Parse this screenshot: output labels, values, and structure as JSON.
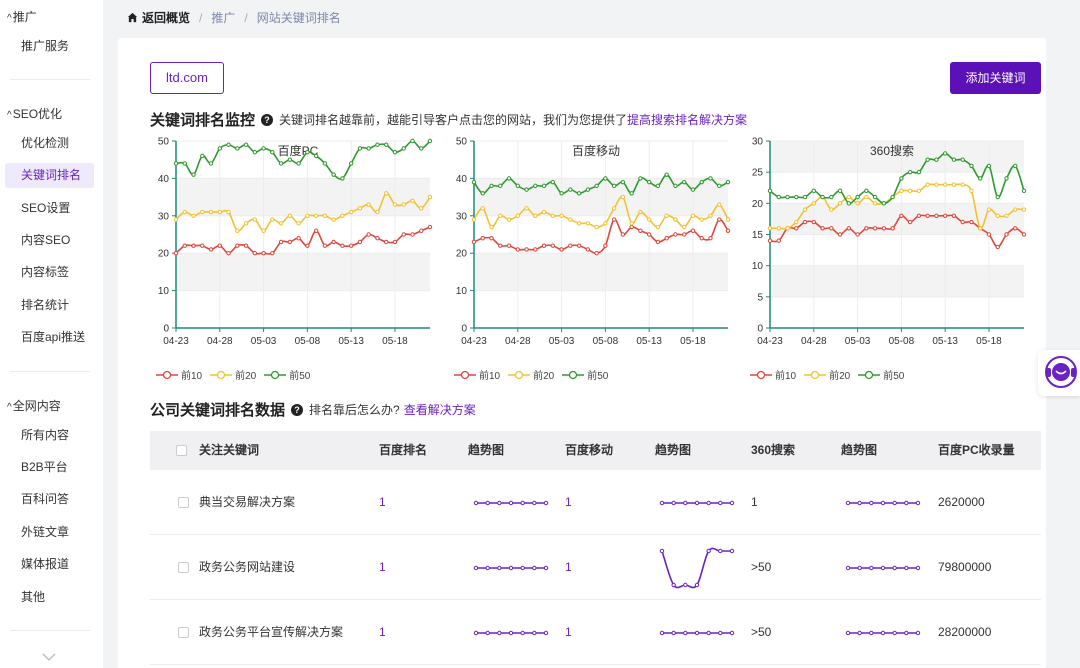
{
  "sidebar": {
    "groups": [
      {
        "title": "推广",
        "items": [
          "推广服务"
        ]
      },
      {
        "title": "SEO优化",
        "items": [
          "优化检测",
          "关键词排名",
          "SEO设置",
          "内容SEO",
          "内容标签",
          "排名统计",
          "百度api推送"
        ]
      },
      {
        "title": "全网内容",
        "items": [
          "所有内容",
          "B2B平台",
          "百科问答",
          "外链文章",
          "媒体报道",
          "其他"
        ]
      }
    ],
    "active_item": "关键词排名",
    "caret": "^"
  },
  "breadcrumb": {
    "home": "返回概览",
    "items": [
      "推广",
      "网站关键词排名"
    ],
    "separator": "/"
  },
  "toolbar": {
    "domain": "ltd.com",
    "add_button": "添加关键词"
  },
  "monitor": {
    "title": "关键词排名监控",
    "desc": "关键词排名越靠前，越能引导客户点击您的网站，我们为您提供了",
    "link": "提高搜索排名解决方案"
  },
  "chart_data": [
    {
      "type": "line",
      "title": "百度PC",
      "x": [
        "04-23",
        "04-24",
        "04-25",
        "04-26",
        "04-27",
        "04-28",
        "04-29",
        "04-30",
        "05-01",
        "05-02",
        "05-03",
        "05-04",
        "05-05",
        "05-06",
        "05-07",
        "05-08",
        "05-09",
        "05-10",
        "05-11",
        "05-12",
        "05-13",
        "05-14",
        "05-15",
        "05-16",
        "05-17",
        "05-18",
        "05-19",
        "05-20",
        "05-21",
        "05-22"
      ],
      "xticks": [
        "04-23",
        "04-28",
        "05-03",
        "05-08",
        "05-13",
        "05-18"
      ],
      "ylim": [
        0,
        50
      ],
      "yticks": [
        0,
        10,
        20,
        30,
        40,
        50
      ],
      "grid": true,
      "series": [
        {
          "name": "前10",
          "color": "#e0463c",
          "values": [
            20,
            22,
            22,
            22,
            21,
            22,
            20,
            22,
            22,
            20,
            20,
            20,
            23,
            23,
            24,
            22,
            26,
            22,
            23,
            22,
            22,
            23,
            25,
            24,
            23,
            23,
            25,
            25,
            26,
            27
          ]
        },
        {
          "name": "前20",
          "color": "#f2c230",
          "values": [
            29,
            31,
            30,
            31,
            31,
            31,
            31,
            26,
            28,
            29,
            26,
            29,
            28,
            30,
            28,
            30,
            30,
            30,
            29,
            30,
            31,
            32,
            33,
            31,
            36,
            33,
            33,
            34,
            32,
            35
          ]
        },
        {
          "name": "前50",
          "color": "#2e9a2e",
          "values": [
            44,
            44,
            41,
            46,
            44,
            48,
            49,
            48,
            49,
            47,
            48,
            47,
            44,
            45,
            44,
            47,
            46,
            44,
            41,
            40,
            44,
            48,
            48,
            49,
            49,
            47,
            48,
            50,
            48,
            50
          ]
        }
      ]
    },
    {
      "type": "line",
      "title": "百度移动",
      "x": [
        "04-23",
        "04-24",
        "04-25",
        "04-26",
        "04-27",
        "04-28",
        "04-29",
        "04-30",
        "05-01",
        "05-02",
        "05-03",
        "05-04",
        "05-05",
        "05-06",
        "05-07",
        "05-08",
        "05-09",
        "05-10",
        "05-11",
        "05-12",
        "05-13",
        "05-14",
        "05-15",
        "05-16",
        "05-17",
        "05-18",
        "05-19",
        "05-20",
        "05-21",
        "05-22"
      ],
      "xticks": [
        "04-23",
        "04-28",
        "05-03",
        "05-08",
        "05-13",
        "05-18"
      ],
      "ylim": [
        0,
        50
      ],
      "yticks": [
        0,
        10,
        20,
        30,
        40,
        50
      ],
      "grid": true,
      "series": [
        {
          "name": "前10",
          "color": "#e0463c",
          "values": [
            23,
            24,
            24,
            22,
            22,
            21,
            21,
            21,
            22,
            22,
            21,
            22,
            22,
            21,
            20,
            22,
            29,
            25,
            27,
            26,
            25,
            23,
            24,
            25,
            25,
            26,
            24,
            24,
            29,
            26
          ]
        },
        {
          "name": "前20",
          "color": "#f2c230",
          "values": [
            29,
            32,
            27,
            30,
            29,
            30,
            32,
            30,
            31,
            30,
            30,
            29,
            28,
            28,
            27,
            28,
            32,
            35,
            28,
            31,
            29,
            27,
            30,
            29,
            27,
            30,
            29,
            30,
            33,
            29
          ]
        },
        {
          "name": "前50",
          "color": "#2e9a2e",
          "values": [
            39,
            36,
            38,
            38,
            40,
            38,
            37,
            38,
            38,
            39,
            36,
            37,
            36,
            37,
            38,
            40,
            38,
            39,
            36,
            40,
            39,
            38,
            41,
            38,
            39,
            37,
            39,
            40,
            38,
            39
          ]
        }
      ]
    },
    {
      "type": "line",
      "title": "360搜索",
      "x": [
        "04-23",
        "04-24",
        "04-25",
        "04-26",
        "04-27",
        "04-28",
        "04-29",
        "04-30",
        "05-01",
        "05-02",
        "05-03",
        "05-04",
        "05-05",
        "05-06",
        "05-07",
        "05-08",
        "05-09",
        "05-10",
        "05-11",
        "05-12",
        "05-13",
        "05-14",
        "05-15",
        "05-16",
        "05-17",
        "05-18",
        "05-19",
        "05-20",
        "05-21",
        "05-22"
      ],
      "xticks": [
        "04-23",
        "04-28",
        "05-03",
        "05-08",
        "05-13",
        "05-18"
      ],
      "ylim": [
        0,
        30
      ],
      "yticks": [
        0,
        5,
        10,
        15,
        20,
        25,
        30
      ],
      "grid": true,
      "series": [
        {
          "name": "前10",
          "color": "#e0463c",
          "values": [
            14,
            14,
            16,
            16,
            17,
            17,
            16,
            16,
            15,
            16,
            15,
            16,
            16,
            16,
            16,
            18,
            17,
            18,
            18,
            18,
            18,
            18,
            17,
            17,
            16,
            15,
            13,
            15,
            16,
            15
          ]
        },
        {
          "name": "前20",
          "color": "#f2c230",
          "values": [
            16,
            16,
            16,
            17,
            19,
            20,
            21,
            19,
            20,
            21,
            20,
            21,
            20,
            20,
            21,
            22,
            22,
            22,
            23,
            23,
            23,
            23,
            23,
            22,
            16,
            19,
            18,
            18,
            19,
            19
          ]
        },
        {
          "name": "前50",
          "color": "#2e9a2e",
          "values": [
            22,
            21,
            21,
            21,
            21,
            22,
            21,
            21,
            22,
            20,
            21,
            22,
            21,
            20,
            21,
            24,
            25,
            25,
            27,
            27,
            28,
            27,
            27,
            26,
            24,
            26,
            21,
            24,
            26,
            22
          ]
        }
      ]
    }
  ],
  "company": {
    "title": "公司关键词排名数据",
    "desc": "排名靠后怎么办?",
    "link": "查看解决方案"
  },
  "table": {
    "headers": [
      "关注关键词",
      "百度排名",
      "趋势图",
      "百度移动",
      "趋势图",
      "360搜索",
      "趋势图",
      "百度PC收录量"
    ],
    "rows": [
      {
        "keyword": "典当交易解决方案",
        "baidu": "1",
        "mobile": "1",
        "s360": "1",
        "count": "2620000",
        "trend_baidu": [
          1,
          1,
          1,
          1,
          1,
          1,
          1
        ],
        "trend_mobile": [
          1,
          1,
          1,
          1,
          1,
          1,
          1
        ],
        "trend_360": [
          1,
          1,
          1,
          1,
          1,
          1,
          1
        ]
      },
      {
        "keyword": "政务公务网站建设",
        "baidu": "1",
        "mobile": "1",
        "s360": ">50",
        "count": "79800000",
        "trend_baidu": [
          1,
          1,
          1,
          1,
          1,
          1,
          1
        ],
        "trend_mobile": [
          1,
          50,
          50,
          50,
          1,
          1,
          1
        ],
        "trend_360": [
          1,
          1,
          1,
          1,
          1,
          1,
          1
        ]
      },
      {
        "keyword": "政务公务平台宣传解决方案",
        "baidu": "1",
        "mobile": "1",
        "s360": ">50",
        "count": "28200000",
        "trend_baidu": [
          1,
          1,
          1,
          1,
          1,
          1,
          1
        ],
        "trend_mobile": [
          1,
          1,
          1,
          1,
          1,
          1,
          1
        ],
        "trend_360": [
          1,
          1,
          1,
          1,
          1,
          1,
          1
        ]
      }
    ]
  },
  "colors": {
    "accent": "#6a22c2",
    "accent_dark": "#5b10b8",
    "axis": "#1e8a7a"
  }
}
